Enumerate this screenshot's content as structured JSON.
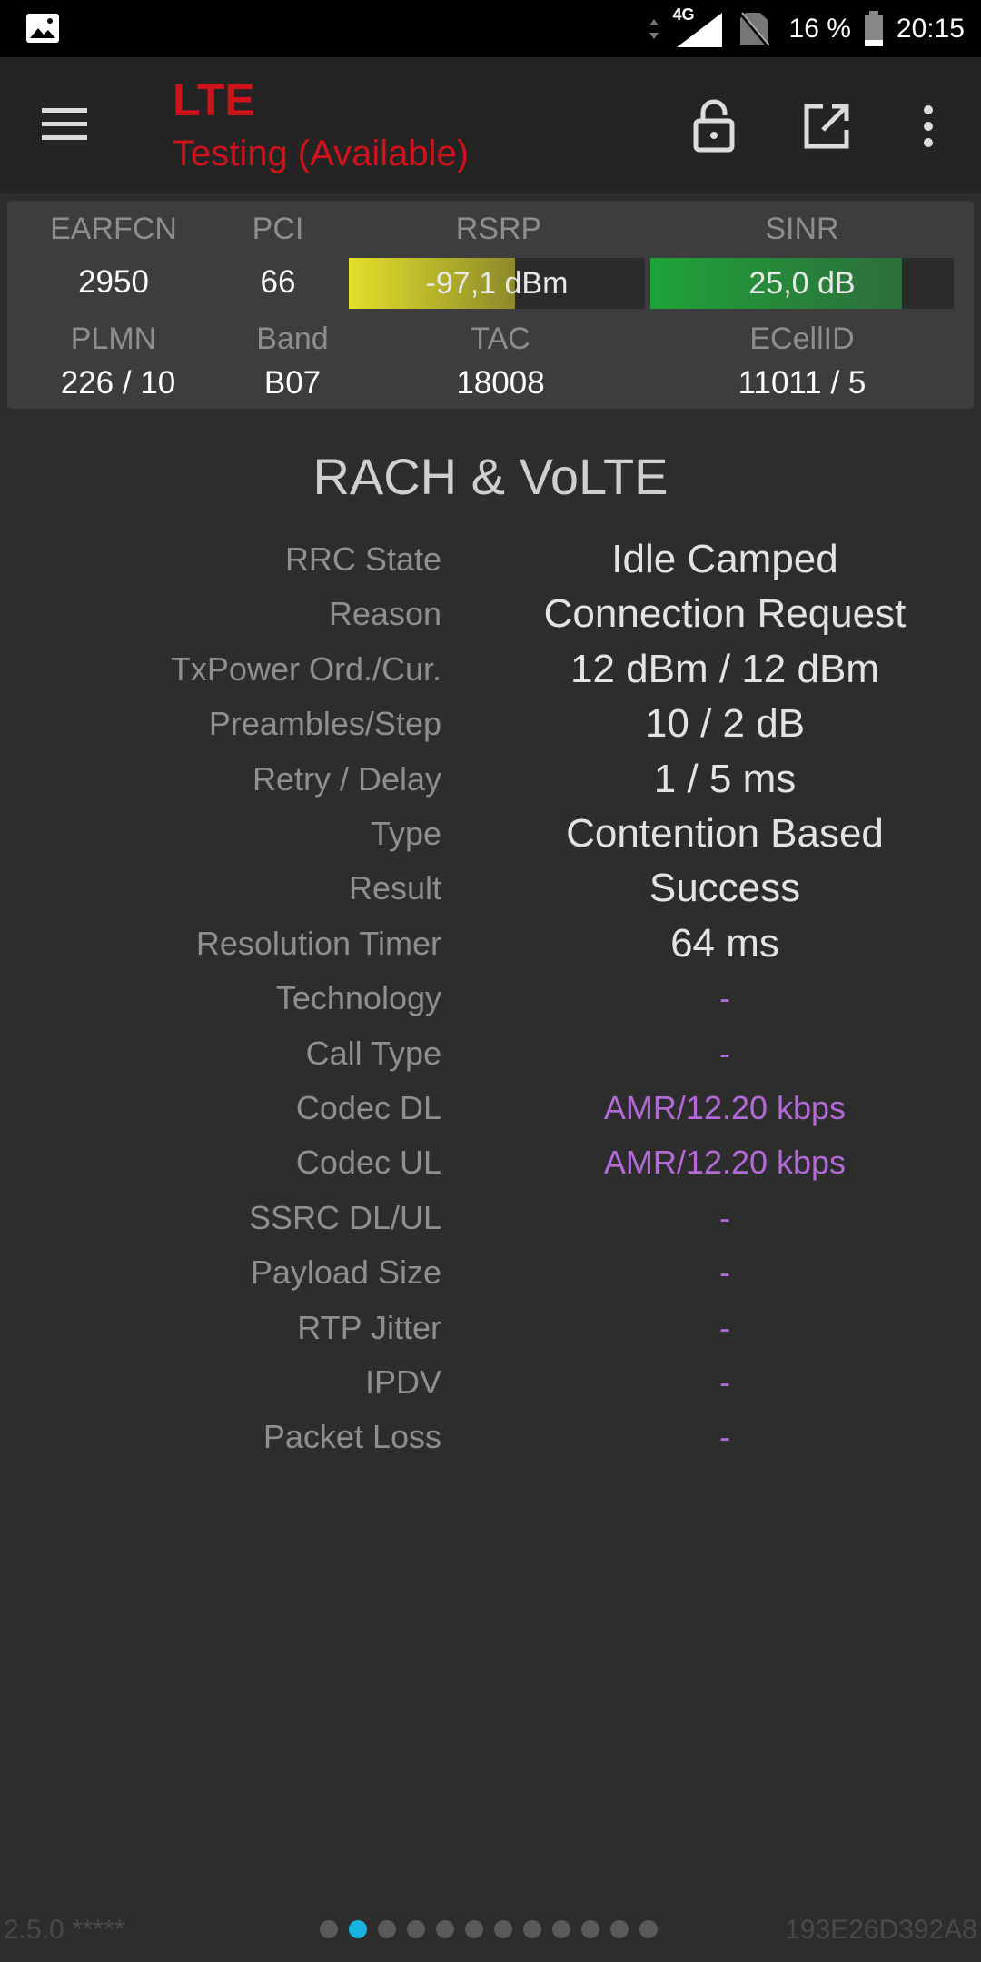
{
  "status_bar": {
    "network": "4G",
    "battery": "16 %",
    "time": "20:15"
  },
  "app_bar": {
    "title": "LTE",
    "subtitle": "Testing (Available)"
  },
  "info": {
    "earfcn_label": "EARFCN",
    "earfcn": "2950",
    "pci_label": "PCI",
    "pci": "66",
    "rsrp_label": "RSRP",
    "rsrp": "-97,1 dBm",
    "rsrp_level": 0.56,
    "sinr_label": "SINR",
    "sinr": "25,0 dB",
    "sinr_level": 0.83,
    "plmn_label": "PLMN",
    "plmn": "226 / 10",
    "band_label": "Band",
    "band": "B07",
    "tac_label": "TAC",
    "tac": "18008",
    "ecellid_label": "ECellID",
    "ecellid": "11011 / 5"
  },
  "section": {
    "title": "RACH & VoLTE",
    "rows": [
      {
        "label": "RRC State",
        "value": "Idle Camped"
      },
      {
        "label": "Reason",
        "value": "Connection Request"
      },
      {
        "label": "TxPower Ord./Cur.",
        "value": "12 dBm / 12 dBm"
      },
      {
        "label": "Preambles/Step",
        "value": "10 / 2 dB"
      },
      {
        "label": "Retry / Delay",
        "value": "1 / 5 ms"
      },
      {
        "label": "Type",
        "value": "Contention Based"
      },
      {
        "label": "Result",
        "value": "Success"
      },
      {
        "label": "Resolution Timer",
        "value": "64 ms"
      },
      {
        "label": "Technology",
        "value": "-"
      },
      {
        "label": "Call Type",
        "value": "-"
      },
      {
        "label": "Codec DL",
        "value": "AMR/12.20 kbps"
      },
      {
        "label": "Codec UL",
        "value": "AMR/12.20 kbps"
      },
      {
        "label": "SSRC DL/UL",
        "value": "-"
      },
      {
        "label": "Payload Size",
        "value": "-"
      },
      {
        "label": "RTP Jitter",
        "value": "-"
      },
      {
        "label": "IPDV",
        "value": "-"
      },
      {
        "label": "Packet Loss",
        "value": "-"
      }
    ]
  },
  "footer": {
    "version": "2.5.0 *****",
    "device_id": "193E26D392A8",
    "page_count": 12,
    "active_page": 2
  },
  "colors": {
    "title_red": "#d0121b",
    "rsrp_yellow": "#e3e02a",
    "sinr_green": "#1fa33a",
    "volte_purple": "#b36ad6",
    "active_dot": "#19b3e0"
  }
}
